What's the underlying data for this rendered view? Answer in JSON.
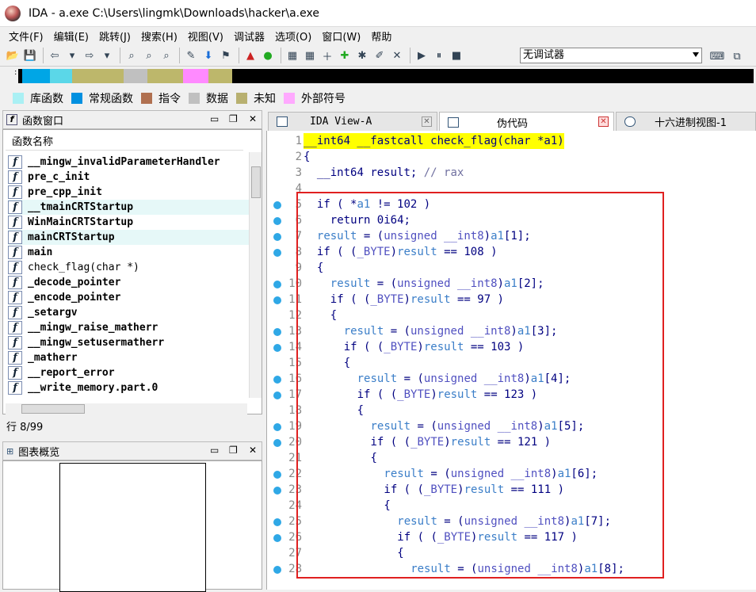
{
  "window": {
    "title": "IDA - a.exe C:\\Users\\lingmk\\Downloads\\hacker\\a.exe"
  },
  "menu": [
    "文件(F)",
    "编辑(E)",
    "跳转(J)",
    "搜索(H)",
    "视图(V)",
    "调试器",
    "选项(O)",
    "窗口(W)",
    "帮助"
  ],
  "toolbar": {
    "debugger_select": "无调试器"
  },
  "navband": {
    "segments": [
      {
        "color": "#000000",
        "w": 5
      },
      {
        "color": "#00a6e6",
        "w": 35
      },
      {
        "color": "#5bd7e8",
        "w": 28
      },
      {
        "color": "#bdb76b",
        "w": 65
      },
      {
        "color": "#c0c0c0",
        "w": 30
      },
      {
        "color": "#bdb76b",
        "w": 45
      },
      {
        "color": "#ff8aff",
        "w": 32
      },
      {
        "color": "#bdb76b",
        "w": 30
      },
      {
        "color": "#000000",
        "w": 620
      }
    ]
  },
  "legend": [
    {
      "label": "库函数",
      "color": "#aaf0f4"
    },
    {
      "label": "常规函数",
      "color": "#0090e0"
    },
    {
      "label": "指令",
      "color": "#b07050"
    },
    {
      "label": "数据",
      "color": "#c0c0c0"
    },
    {
      "label": "未知",
      "color": "#b8b070"
    },
    {
      "label": "外部符号",
      "color": "#ffaaff"
    }
  ],
  "functions_window": {
    "title": "函数窗口",
    "column": "函数名称",
    "status": "行 8/99",
    "items": [
      {
        "name": "__mingw_invalidParameterHandler",
        "lib": false
      },
      {
        "name": "pre_c_init",
        "lib": false
      },
      {
        "name": "pre_cpp_init",
        "lib": false
      },
      {
        "name": "__tmainCRTStartup",
        "lib": true
      },
      {
        "name": "WinMainCRTStartup",
        "lib": false
      },
      {
        "name": "mainCRTStartup",
        "lib": true
      },
      {
        "name": "main",
        "lib": false
      },
      {
        "name": "check_flag(char *)",
        "lib": false,
        "selected": true
      },
      {
        "name": "_decode_pointer",
        "lib": false
      },
      {
        "name": "_encode_pointer",
        "lib": false
      },
      {
        "name": "_setargv",
        "lib": false
      },
      {
        "name": "__mingw_raise_matherr",
        "lib": false
      },
      {
        "name": "__mingw_setusermatherr",
        "lib": false
      },
      {
        "name": "_matherr",
        "lib": false
      },
      {
        "name": "__report_error",
        "lib": false
      },
      {
        "name": "__write_memory.part.0",
        "lib": false
      }
    ]
  },
  "graph_overview": {
    "title": "图表概览"
  },
  "tabs": [
    {
      "label": "IDA View-A"
    },
    {
      "label": "伪代码"
    },
    {
      "label": "十六进制视图-1"
    }
  ],
  "code_lines": [
    {
      "n": "1",
      "dot": false,
      "hl": true,
      "i": 0,
      "h": "__int64 __fastcall check_flag(char *a1)"
    },
    {
      "n": "2",
      "dot": false,
      "i": 0,
      "h": "{"
    },
    {
      "n": "3",
      "dot": false,
      "i": 2,
      "h": "__int64 result; <span class='d'>// rax</span>"
    },
    {
      "n": "4",
      "dot": false,
      "i": 0,
      "h": ""
    },
    {
      "n": "5",
      "dot": true,
      "i": 2,
      "h": "if ( *<span class='v'>a1</span> != 102 )"
    },
    {
      "n": "6",
      "dot": true,
      "i": 4,
      "h": "return 0i64;"
    },
    {
      "n": "7",
      "dot": true,
      "i": 2,
      "h": "<span class='v'>result</span> = (<span class='c'>unsigned __int8</span>)<span class='v'>a1</span>[1];"
    },
    {
      "n": "8",
      "dot": true,
      "i": 2,
      "h": "if ( (<span class='c'>_BYTE</span>)<span class='v'>result</span> == 108 )"
    },
    {
      "n": "9",
      "dot": false,
      "i": 2,
      "h": "{"
    },
    {
      "n": "10",
      "dot": true,
      "i": 4,
      "h": "<span class='v'>result</span> = (<span class='c'>unsigned __int8</span>)<span class='v'>a1</span>[2];"
    },
    {
      "n": "11",
      "dot": true,
      "i": 4,
      "h": "if ( (<span class='c'>_BYTE</span>)<span class='v'>result</span> == 97 )"
    },
    {
      "n": "12",
      "dot": false,
      "i": 4,
      "h": "{"
    },
    {
      "n": "13",
      "dot": true,
      "i": 6,
      "h": "<span class='v'>result</span> = (<span class='c'>unsigned __int8</span>)<span class='v'>a1</span>[3];"
    },
    {
      "n": "14",
      "dot": true,
      "i": 6,
      "h": "if ( (<span class='c'>_BYTE</span>)<span class='v'>result</span> == 103 )"
    },
    {
      "n": "15",
      "dot": false,
      "i": 6,
      "h": "{"
    },
    {
      "n": "16",
      "dot": true,
      "i": 8,
      "h": "<span class='v'>result</span> = (<span class='c'>unsigned __int8</span>)<span class='v'>a1</span>[4];"
    },
    {
      "n": "17",
      "dot": true,
      "i": 8,
      "h": "if ( (<span class='c'>_BYTE</span>)<span class='v'>result</span> == 123 )"
    },
    {
      "n": "18",
      "dot": false,
      "i": 8,
      "h": "{"
    },
    {
      "n": "19",
      "dot": true,
      "i": 10,
      "h": "<span class='v'>result</span> = (<span class='c'>unsigned __int8</span>)<span class='v'>a1</span>[5];"
    },
    {
      "n": "20",
      "dot": true,
      "i": 10,
      "h": "if ( (<span class='c'>_BYTE</span>)<span class='v'>result</span> == 121 )"
    },
    {
      "n": "21",
      "dot": false,
      "i": 10,
      "h": "{"
    },
    {
      "n": "22",
      "dot": true,
      "i": 12,
      "h": "<span class='v'>result</span> = (<span class='c'>unsigned __int8</span>)<span class='v'>a1</span>[6];"
    },
    {
      "n": "23",
      "dot": true,
      "i": 12,
      "h": "if ( (<span class='c'>_BYTE</span>)<span class='v'>result</span> == 111 )"
    },
    {
      "n": "24",
      "dot": false,
      "i": 12,
      "h": "{"
    },
    {
      "n": "25",
      "dot": true,
      "i": 14,
      "h": "<span class='v'>result</span> = (<span class='c'>unsigned __int8</span>)<span class='v'>a1</span>[7];"
    },
    {
      "n": "26",
      "dot": true,
      "i": 14,
      "h": "if ( (<span class='c'>_BYTE</span>)<span class='v'>result</span> == 117 )"
    },
    {
      "n": "27",
      "dot": false,
      "i": 14,
      "h": "{"
    },
    {
      "n": "28",
      "dot": true,
      "i": 16,
      "h": "<span class='v'>result</span> = (<span class='c'>unsigned __int8</span>)<span class='v'>a1</span>[8];"
    }
  ]
}
